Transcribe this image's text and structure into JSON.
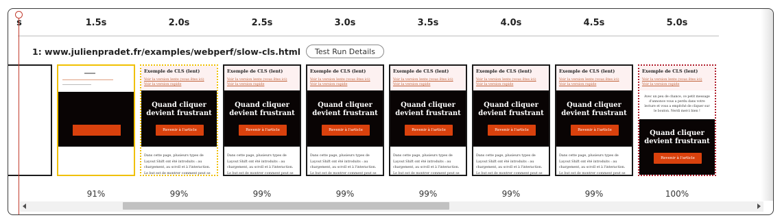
{
  "timeline": {
    "ticks": [
      "s",
      "1.5s",
      "2.0s",
      "2.5s",
      "3.0s",
      "3.5s",
      "4.0s",
      "4.5s",
      "5.0s"
    ]
  },
  "run": {
    "url": "1: www.julienpradet.fr/examples/webperf/slow-cls.html",
    "details_button": "Test Run Details"
  },
  "page_preview": {
    "header_title": "Exemple de CLS (lent)",
    "link1": "Voir la version lente (vous êtes ici)",
    "link2": "Voir la version rapide",
    "hero_title": "Quand cliquer devient frustrant",
    "cta": "Revenir à l'article",
    "body_text": "Dans cette page, plusieurs types de Layout Shift ont été introduits : au chargement, au scroll et à l'interaction. Le but est de montrer comment peut se tromper sur les pages",
    "notice": "Avec un peu de chance, ce petit message d'annonce vous a perdu dans votre lecture et vous a empêché de cliquer sur le bouton. Nerdi merci bien !"
  },
  "frames": [
    {
      "percent": "",
      "state": "blank",
      "border": "solid"
    },
    {
      "percent": "91%",
      "state": "skeleton",
      "border": "yellow"
    },
    {
      "percent": "99%",
      "state": "full",
      "border": "yellow-dot"
    },
    {
      "percent": "99%",
      "state": "full",
      "border": "solid"
    },
    {
      "percent": "99%",
      "state": "full",
      "border": "solid"
    },
    {
      "percent": "99%",
      "state": "full",
      "border": "solid"
    },
    {
      "percent": "99%",
      "state": "full",
      "border": "solid"
    },
    {
      "percent": "99%",
      "state": "full",
      "border": "solid"
    },
    {
      "percent": "100%",
      "state": "shifted",
      "border": "red-dot"
    }
  ],
  "colors": {
    "cursor": "#c0392b",
    "changed_frame": "#f0c000",
    "final_frame": "#b01c2a",
    "cta": "#d9410d"
  }
}
